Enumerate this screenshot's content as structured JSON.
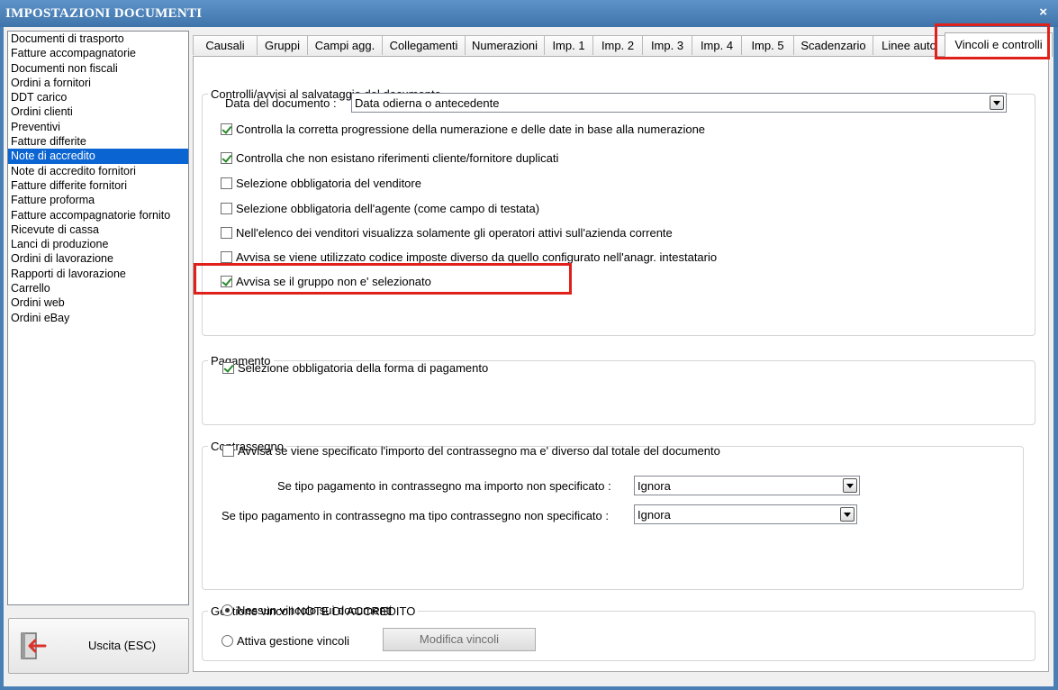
{
  "window": {
    "title": "IMPOSTAZIONI DOCUMENTI",
    "close_glyph": "×"
  },
  "doc_types": [
    "Documenti di trasporto",
    "Fatture accompagnatorie",
    "Documenti non fiscali",
    "Ordini a fornitori",
    "DDT carico",
    "Ordini clienti",
    "Preventivi",
    "Fatture differite",
    "Note di accredito",
    "Note di accredito fornitori",
    "Fatture differite fornitori",
    "Fatture proforma",
    "Fatture accompagnatorie fornito",
    "Ricevute di cassa",
    "Lanci di produzione",
    "Ordini di lavorazione",
    "Rapporti di lavorazione",
    "Carrello",
    "Ordini web",
    "Ordini eBay"
  ],
  "selected_doc_type": "Note di accredito",
  "exit_button": {
    "label": "Uscita (ESC)",
    "icon": "exit-door-icon"
  },
  "tabs": [
    "Causali",
    "Gruppi",
    "Campi agg.",
    "Collegamenti",
    "Numerazioni",
    "Imp. 1",
    "Imp. 2",
    "Imp. 3",
    "Imp. 4",
    "Imp. 5",
    "Scadenzario",
    "Linee auto",
    "Vincoli e controlli"
  ],
  "active_tab": "Vincoli e controlli",
  "controlli": {
    "legend": "Controlli/avvisi al salvataggio del documento",
    "data_label": "Data del documento :",
    "data_value": "Data odierna o antecedente",
    "checks": [
      {
        "label": "Controlla la corretta progressione della numerazione e delle date in base alla numerazione",
        "checked": true
      },
      {
        "label": "Controlla che non esistano riferimenti cliente/fornitore duplicati",
        "checked": true
      },
      {
        "label": "Selezione obbligatoria del venditore",
        "checked": false
      },
      {
        "label": "Selezione obbligatoria dell'agente (come campo di testata)",
        "checked": false
      },
      {
        "label": "Nell'elenco dei venditori visualizza solamente gli operatori attivi sull'azienda corrente",
        "checked": false
      },
      {
        "label": "Avvisa se viene utilizzato codice imposte diverso da quello configurato nell'anagr. intestatario",
        "checked": false
      },
      {
        "label": "Avvisa se il gruppo non e' selezionato",
        "checked": true
      }
    ]
  },
  "pagamento": {
    "legend": "Pagamento",
    "check": {
      "label": "Selezione obbligatoria della forma di pagamento",
      "checked": true
    }
  },
  "contrassegno": {
    "legend": "Contrassegno",
    "check": {
      "label": "Avvisa se viene specificato l'importo del contrassegno ma e' diverso dal totale del documento",
      "checked": false
    },
    "importo_label": "Se tipo pagamento in contrassegno ma importo non specificato :",
    "importo_value": "Ignora",
    "tipo_label": "Se tipo pagamento in contrassegno ma tipo contrassegno non specificato :",
    "tipo_value": "Ignora"
  },
  "vincoli": {
    "legend": "Gestione vincoli NOTE DI ACCREDITO",
    "radio1": {
      "label": "Nessun vincolo sui documenti",
      "selected": true
    },
    "radio2": {
      "label": "Attiva gestione vincoli",
      "selected": false
    },
    "modify_button": "Modifica vincoli"
  },
  "colors": {
    "title_bar": "#4a7fb5",
    "selection": "#0a64d2",
    "highlight_box": "#e0201a"
  }
}
